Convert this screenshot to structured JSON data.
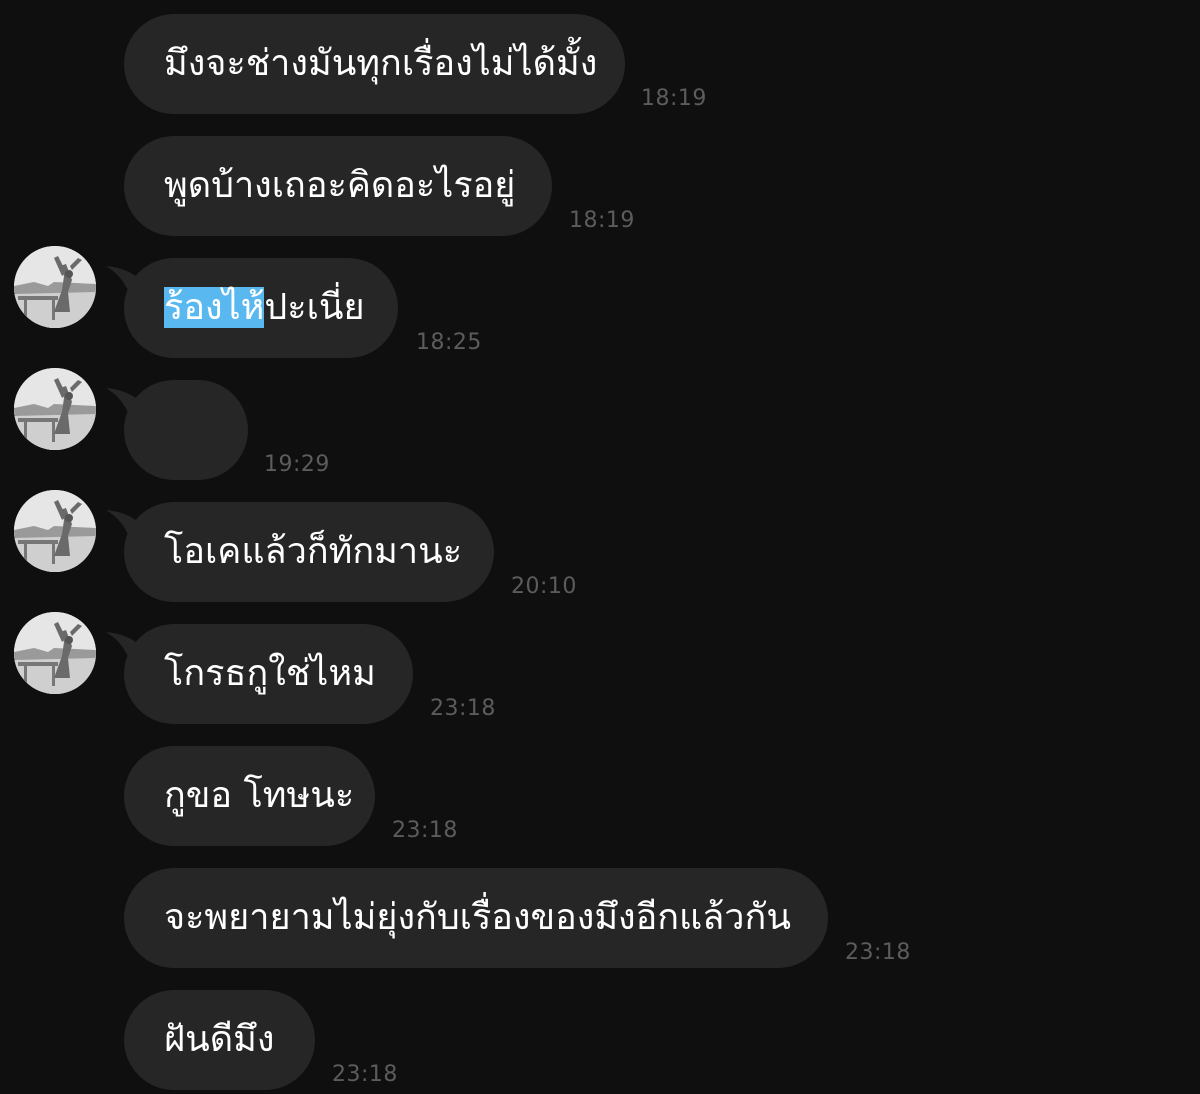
{
  "messages": [
    {
      "text": "มึงจะช่างมันทุกเรื่องไม่ได้มั้ง",
      "time": "18:19",
      "avatar": false
    },
    {
      "text": "พูดบ้างเถอะคิดอะไรอยู่",
      "time": "18:19",
      "avatar": false
    },
    {
      "text_selected": "ร้องไห้",
      "text_rest": "ปะเนี่ย",
      "time": "18:25",
      "avatar": true
    },
    {
      "text": "",
      "time": "19:29",
      "avatar": true
    },
    {
      "text": "โอเคแล้วก็ทักมานะ",
      "time": "20:10",
      "avatar": true
    },
    {
      "text": "โกรธกูใช่ไหม",
      "time": "23:18",
      "avatar": true
    },
    {
      "text": "กูขอ โทษนะ",
      "time": "23:18",
      "avatar": false
    },
    {
      "text": "จะพยายามไม่ยุ่งกับเรื่องของมึงอีกแล้วกัน",
      "time": "23:18",
      "avatar": false
    },
    {
      "text": "ฝันดีมึง",
      "time": "23:18",
      "avatar": false
    }
  ],
  "colors": {
    "background": "#0f0f10",
    "bubble": "#262626",
    "message_text": "#ffffff",
    "timestamp": "#5c5c5c",
    "selection": "#5ab8f0"
  },
  "icons": {
    "avatar": "profile-photo-icon"
  }
}
